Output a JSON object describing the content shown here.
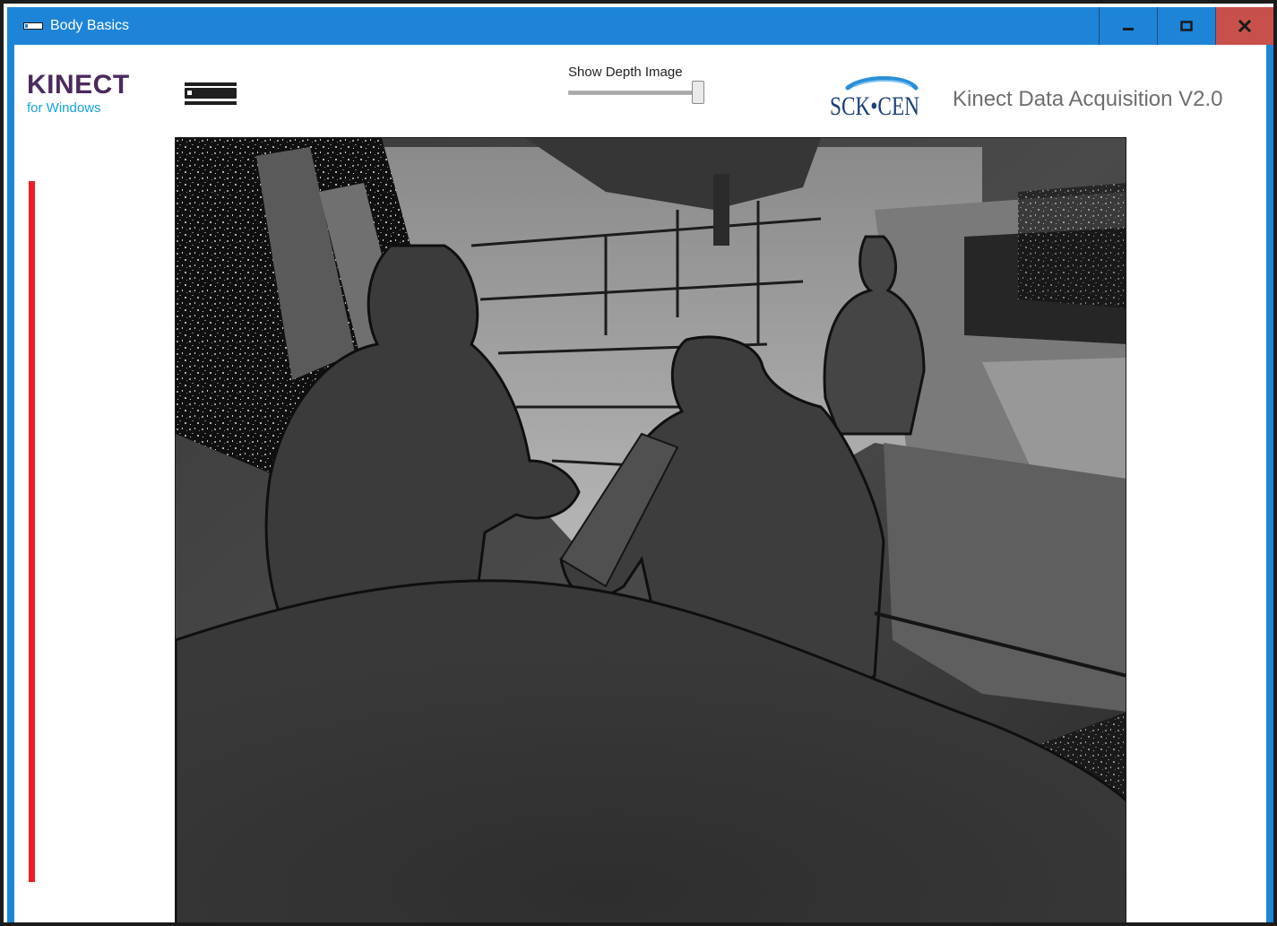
{
  "window": {
    "title": "Body Basics",
    "controls": {
      "minimize_icon": "minimize-icon",
      "maximize_icon": "maximize-icon",
      "close_icon": "close-icon"
    },
    "accent_color": "#1e84d8",
    "close_color": "#c8504b"
  },
  "header": {
    "kinect_logo": {
      "word": "KINECT",
      "sub": "for Windows",
      "word_color": "#4b2a5e",
      "sub_color": "#16a3dd"
    },
    "sensor_icon": "kinect-sensor-icon",
    "depth_toggle": {
      "label": "Show Depth Image",
      "value": 1.0
    },
    "partner_logo": {
      "text": "SCK•CEN"
    },
    "app_title": "Kinect Data Acquisition V2.0"
  },
  "status": {
    "indicator_color": "#ef1c25"
  },
  "viewport": {
    "content": "depth-image"
  }
}
